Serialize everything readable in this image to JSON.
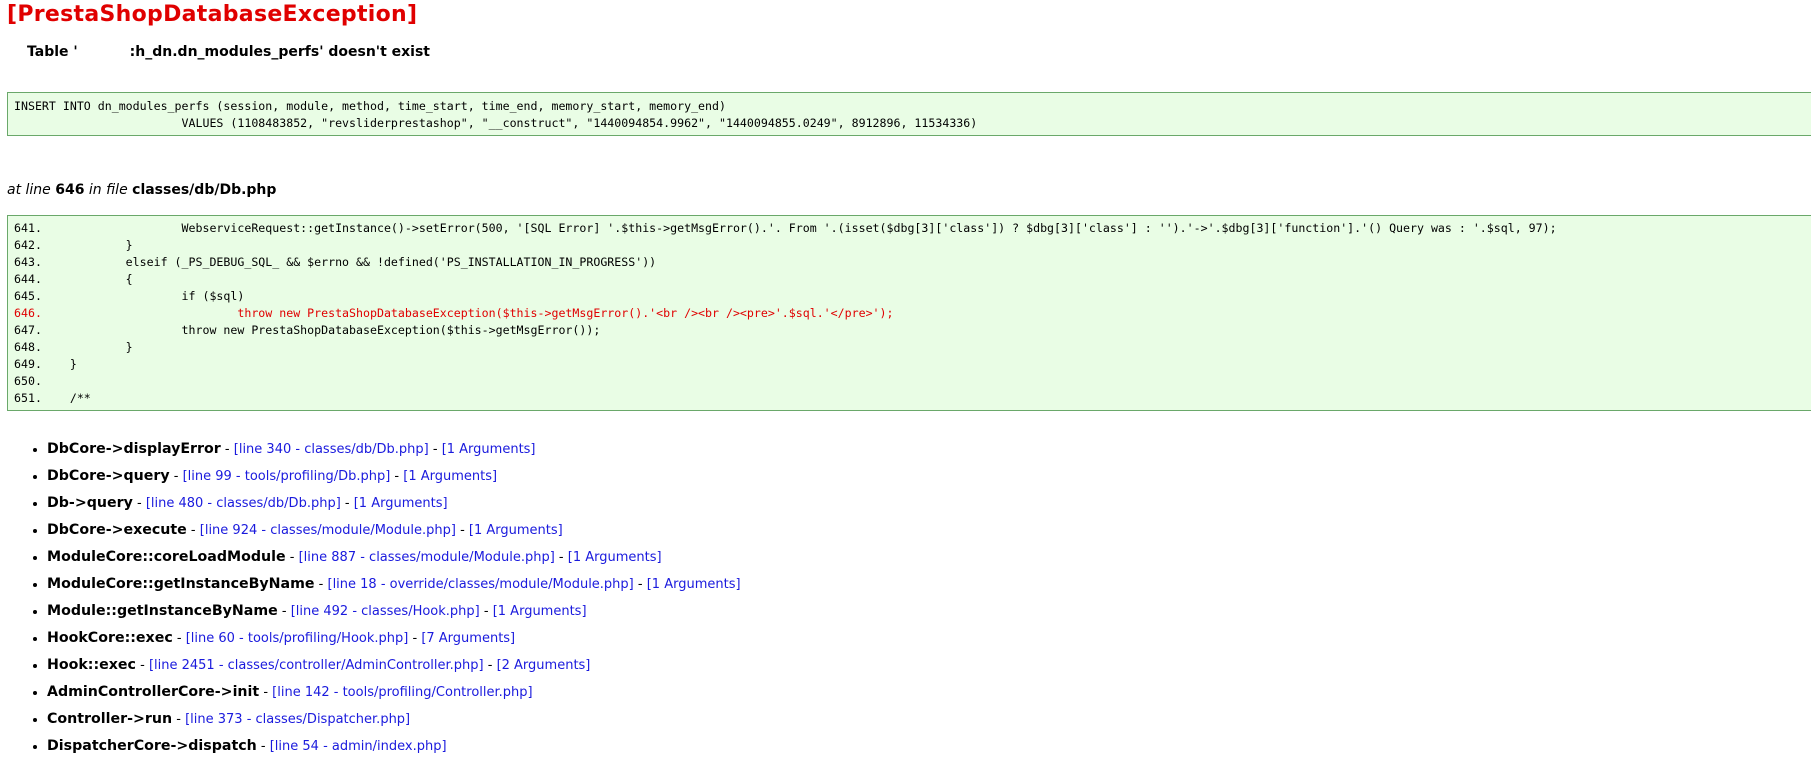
{
  "error": {
    "title": "[PrestaShopDatabaseException]",
    "message_prefix": "Table '",
    "message_suffix": ":h_dn.dn_modules_perfs' doesn't exist"
  },
  "sql": {
    "line1": "INSERT INTO dn_modules_perfs (session, module, method, time_start, time_end, memory_start, memory_end)",
    "line2": "                        VALUES (1108483852, \"revsliderprestashop\", \"__construct\", \"1440094854.9962\", \"1440094855.0249\", 8912896, 11534336)"
  },
  "location": {
    "prefix": "at line ",
    "line": "646",
    "middle": " in file ",
    "file": "classes/db/Db.php"
  },
  "code": [
    {
      "text": "641.                    WebserviceRequest::getInstance()->setError(500, '[SQL Error] '.$this->getMsgError().'. From '.(isset($dbg[3]['class']) ? $dbg[3]['class'] : '').'->'.$dbg[3]['function'].'() Query was : '.$sql, 97);",
      "highlight": false
    },
    {
      "text": "642.            }",
      "highlight": false
    },
    {
      "text": "643.            elseif (_PS_DEBUG_SQL_ && $errno && !defined('PS_INSTALLATION_IN_PROGRESS'))",
      "highlight": false
    },
    {
      "text": "644.            {",
      "highlight": false
    },
    {
      "text": "645.                    if ($sql)",
      "highlight": false
    },
    {
      "text": "646.                            throw new PrestaShopDatabaseException($this->getMsgError().'<br /><br /><pre>'.$sql.'</pre>');",
      "highlight": true
    },
    {
      "text": "647.                    throw new PrestaShopDatabaseException($this->getMsgError());",
      "highlight": false
    },
    {
      "text": "648.            }",
      "highlight": false
    },
    {
      "text": "649.    }",
      "highlight": false
    },
    {
      "text": "650.",
      "highlight": false
    },
    {
      "text": "651.    /**",
      "highlight": false
    }
  ],
  "trace": [
    {
      "fn": "DbCore->displayError",
      "loc": "[line 340 - classes/db/Db.php]",
      "args": "[1 Arguments]"
    },
    {
      "fn": "DbCore->query",
      "loc": "[line 99 - tools/profiling/Db.php]",
      "args": "[1 Arguments]"
    },
    {
      "fn": "Db->query",
      "loc": "[line 480 - classes/db/Db.php]",
      "args": "[1 Arguments]"
    },
    {
      "fn": "DbCore->execute",
      "loc": "[line 924 - classes/module/Module.php]",
      "args": "[1 Arguments]"
    },
    {
      "fn": "ModuleCore::coreLoadModule",
      "loc": "[line 887 - classes/module/Module.php]",
      "args": "[1 Arguments]"
    },
    {
      "fn": "ModuleCore::getInstanceByName",
      "loc": "[line 18 - override/classes/module/Module.php]",
      "args": "[1 Arguments]"
    },
    {
      "fn": "Module::getInstanceByName",
      "loc": "[line 492 - classes/Hook.php]",
      "args": "[1 Arguments]"
    },
    {
      "fn": "HookCore::exec",
      "loc": "[line 60 - tools/profiling/Hook.php]",
      "args": "[7 Arguments]"
    },
    {
      "fn": "Hook::exec",
      "loc": "[line 2451 - classes/controller/AdminController.php]",
      "args": "[2 Arguments]"
    },
    {
      "fn": "AdminControllerCore->init",
      "loc": "[line 142 - tools/profiling/Controller.php]",
      "args": ""
    },
    {
      "fn": "Controller->run",
      "loc": "[line 373 - classes/Dispatcher.php]",
      "args": ""
    },
    {
      "fn": "DispatcherCore->dispatch",
      "loc": "[line 54 - admin/index.php]",
      "args": ""
    }
  ],
  "separator": " - ",
  "colors": {
    "title": "#e00000",
    "box_bg": "#e9fde5",
    "box_border": "#6aa86a",
    "link": "#1a1add",
    "highlight": "#e00000"
  }
}
